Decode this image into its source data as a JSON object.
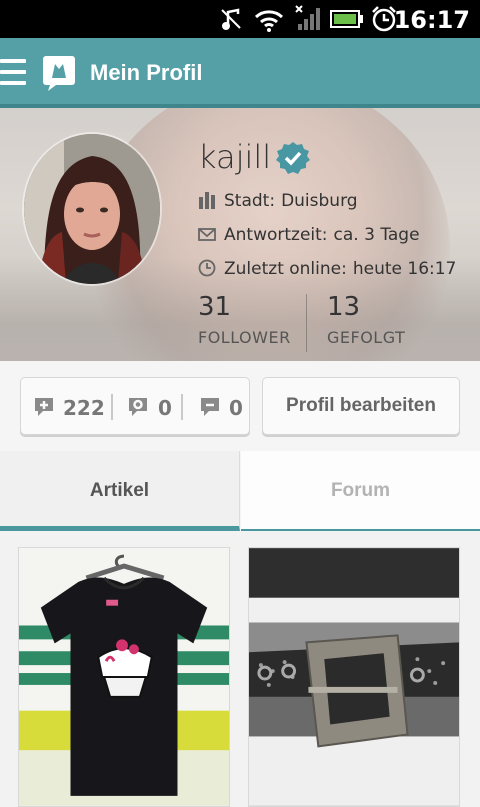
{
  "status_bar": {
    "time": "16:17",
    "icons": [
      "headphones-icon",
      "wifi-icon",
      "signal-icon",
      "battery-icon",
      "alarm-icon"
    ]
  },
  "app_bar": {
    "title": "Mein Profil",
    "menu_icon": "hamburger-icon",
    "logo_icon": "app-logo-icon"
  },
  "profile": {
    "username": "kajill",
    "verified": true,
    "city_label": "Stadt:",
    "city_value": "Duisburg",
    "response_label": "Antwortzeit:",
    "response_value": "ca. 3 Tage",
    "last_online_label": "Zuletzt online:",
    "last_online_value": "heute 16:17",
    "followers_count": "31",
    "followers_label": "FOLLOWER",
    "following_count": "13",
    "following_label": "GEFOLGT"
  },
  "actions": {
    "positive_count": "222",
    "neutral_count": "0",
    "negative_count": "0",
    "edit_profile_label": "Profil bearbeiten"
  },
  "tabs": [
    {
      "label": "Artikel",
      "active": true
    },
    {
      "label": "Forum",
      "active": false
    }
  ],
  "colors": {
    "accent": "#55a0a7",
    "tab_indicator": "#4a979e",
    "verified": "#4a97a4"
  }
}
